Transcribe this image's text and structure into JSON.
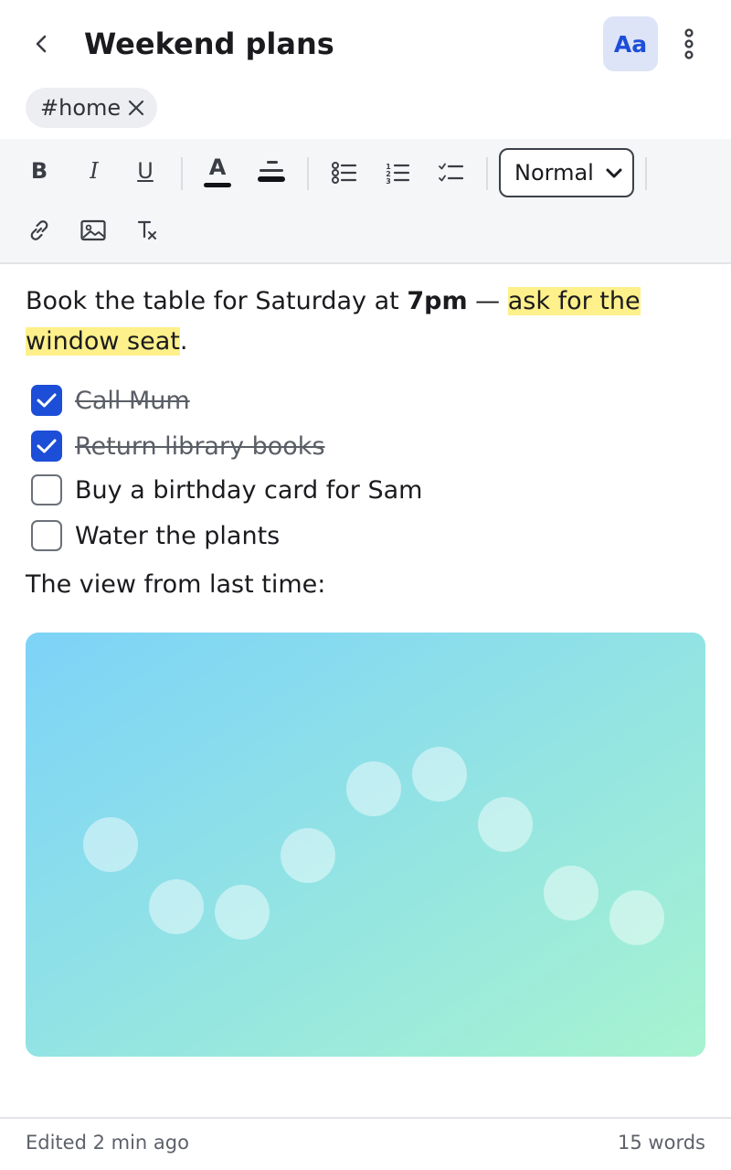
{
  "header": {
    "title": "Weekend plans",
    "format_button_label": "Aa",
    "back_icon": "chevron-left-icon",
    "more_icon": "more-vertical-icon"
  },
  "tags": [
    {
      "label": "#home"
    }
  ],
  "toolbar": {
    "bold_label": "B",
    "italic_label": "I",
    "underline_label": "U",
    "text_color_label": "A",
    "block_style": {
      "selected": "Normal"
    },
    "icons": [
      "bold-icon",
      "italic-icon",
      "underline-icon",
      "text-color-icon",
      "highlight-icon",
      "bullet-list-icon",
      "numbered-list-icon",
      "checklist-icon",
      "link-icon",
      "image-icon",
      "clear-format-icon"
    ]
  },
  "content": {
    "paragraph": {
      "text_before": "Book the table for Saturday at ",
      "bold": "7pm",
      "text_mid": " — ",
      "highlighted": "ask for the window seat",
      "text_after": "."
    },
    "checklist": [
      {
        "label": "Call Mum",
        "checked": true
      },
      {
        "label": "Return library books",
        "checked": true
      },
      {
        "label": "Buy a birthday card for Sam",
        "checked": false
      },
      {
        "label": "Water the plants",
        "checked": false
      }
    ],
    "paragraph2": "The view from last time:",
    "image": {
      "gradient_start": "#7dd3f8",
      "gradient_end": "#a7f3d0"
    }
  },
  "footer": {
    "edited": "Edited 2 min ago",
    "word_count": "15 words"
  },
  "colors": {
    "accent": "#1d4ed8",
    "accent_soft": "#dde4f7",
    "highlight": "#fef08a"
  }
}
